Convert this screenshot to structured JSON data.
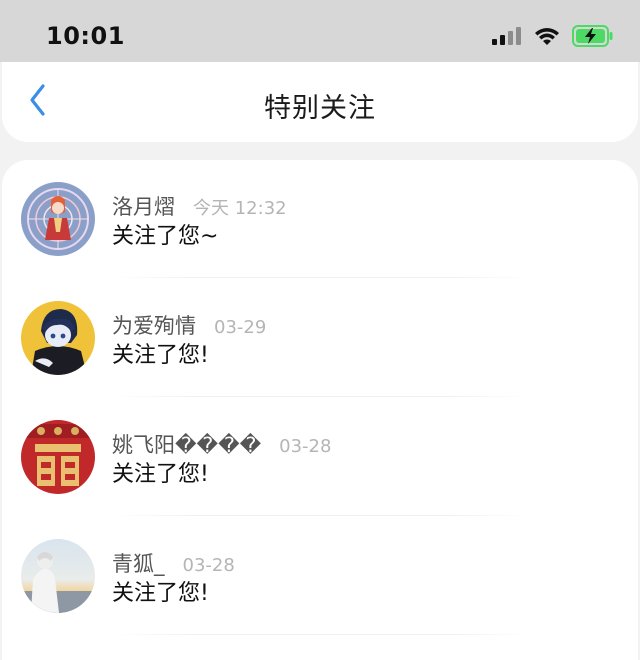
{
  "status_bar": {
    "time": "10:01",
    "icons": [
      "cellular-signal-icon",
      "wifi-icon",
      "battery-charging-icon"
    ],
    "battery_color": "#4cd964"
  },
  "nav": {
    "back_icon": "chevron-left-icon",
    "title": "特别关注",
    "accent_color": "#3a8ee6"
  },
  "items": [
    {
      "name": "洛月熠",
      "time": "今天 12:32",
      "message": "关注了您~"
    },
    {
      "name": "为爱殉情",
      "time": "03-29",
      "message": "关注了您!"
    },
    {
      "name": "姚飞阳����",
      "time": "03-28",
      "message": "关注了您!"
    },
    {
      "name": "青狐_",
      "time": "03-28",
      "message": "关注了您!"
    }
  ]
}
